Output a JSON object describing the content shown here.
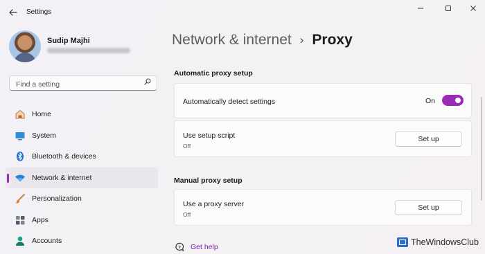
{
  "window": {
    "title": "Settings",
    "back_icon": "back-arrow-icon",
    "controls": {
      "minimize": "–",
      "maximize": "☐",
      "close": "✕"
    }
  },
  "user": {
    "name": "Sudip Majhi"
  },
  "search": {
    "placeholder": "Find a setting",
    "icon": "search-icon"
  },
  "nav": {
    "items": [
      {
        "label": "Home",
        "icon": "home-icon",
        "active": false
      },
      {
        "label": "System",
        "icon": "system-icon",
        "active": false
      },
      {
        "label": "Bluetooth & devices",
        "icon": "bluetooth-icon",
        "active": false
      },
      {
        "label": "Network & internet",
        "icon": "wifi-icon",
        "active": true
      },
      {
        "label": "Personalization",
        "icon": "brush-icon",
        "active": false
      },
      {
        "label": "Apps",
        "icon": "apps-icon",
        "active": false
      },
      {
        "label": "Accounts",
        "icon": "accounts-icon",
        "active": false
      }
    ]
  },
  "breadcrumb": {
    "parent": "Network & internet",
    "separator": "›",
    "current": "Proxy"
  },
  "automatic": {
    "section_title": "Automatic proxy setup",
    "detect": {
      "label": "Automatically detect settings",
      "toggle_label": "On",
      "toggle_on": true
    },
    "script": {
      "label": "Use setup script",
      "status": "Off",
      "button": "Set up"
    }
  },
  "manual": {
    "section_title": "Manual proxy setup",
    "server": {
      "label": "Use a proxy server",
      "status": "Off",
      "button": "Set up"
    }
  },
  "help": {
    "label": "Get help",
    "icon": "help-icon"
  },
  "watermark": {
    "text": "TheWindowsClub"
  },
  "colors": {
    "accent": "#9b2bb5",
    "link": "#7a1f9a",
    "background": "#f3f1f6",
    "card": "#fbfbfc"
  }
}
